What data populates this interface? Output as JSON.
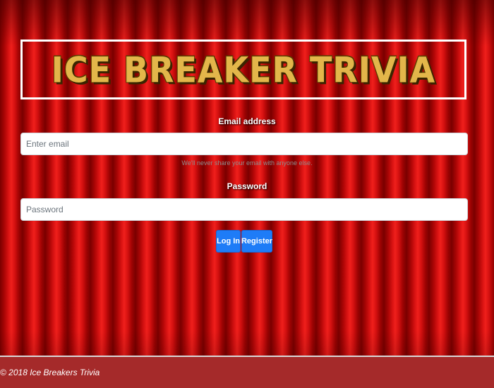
{
  "header": {
    "title": "ICE BREAKER TRIVIA"
  },
  "form": {
    "email_label": "Email address",
    "email_placeholder": "Enter email",
    "email_value": "",
    "email_help": "We'll never share your email with anyone else.",
    "password_label": "Password",
    "password_placeholder": "Password",
    "password_value": "",
    "login_label": "Log In",
    "register_label": "Register"
  },
  "footer": {
    "text": "© 2018 Ice Breakers Trivia"
  },
  "colors": {
    "curtain": "#c40a0a",
    "title_gold": "#e3b64a",
    "button_blue": "#1e7cf7",
    "footer_bg": "#a52a2a"
  }
}
